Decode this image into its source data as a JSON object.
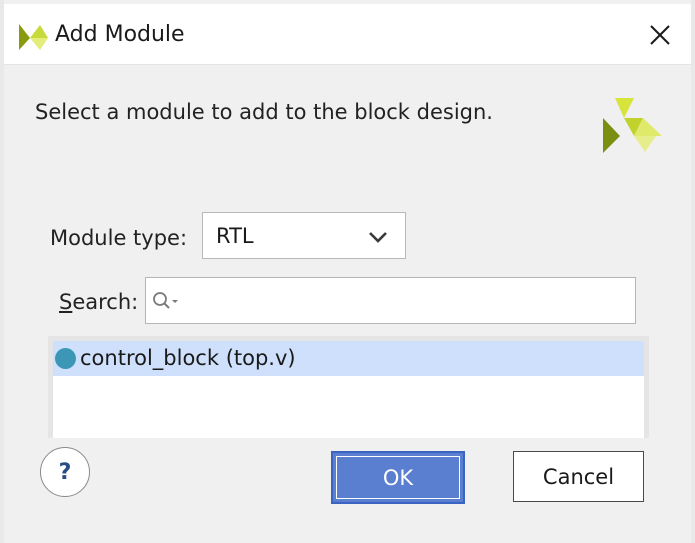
{
  "window": {
    "title": "Add Module",
    "logo_icon": "vivado-logo-icon",
    "close_icon": "close-icon"
  },
  "main": {
    "prompt": "Select a module to add to the block design.",
    "module_type": {
      "label": "Module type:",
      "selected": "RTL"
    },
    "search": {
      "label_prefix": "S",
      "label_rest": "earch:",
      "value": "",
      "icon": "search-icon"
    },
    "modules": [
      {
        "label": "control_block (top.v)",
        "selected": true,
        "status_color": "#3b97b5"
      }
    ]
  },
  "footer": {
    "help_label": "?",
    "ok_label": "OK",
    "cancel_label": "Cancel"
  },
  "colors": {
    "accent": "#5a7fd1",
    "selection": "#cfe0fc",
    "logo_dark": "#7a8e12",
    "logo_light": "#dbe84a"
  }
}
